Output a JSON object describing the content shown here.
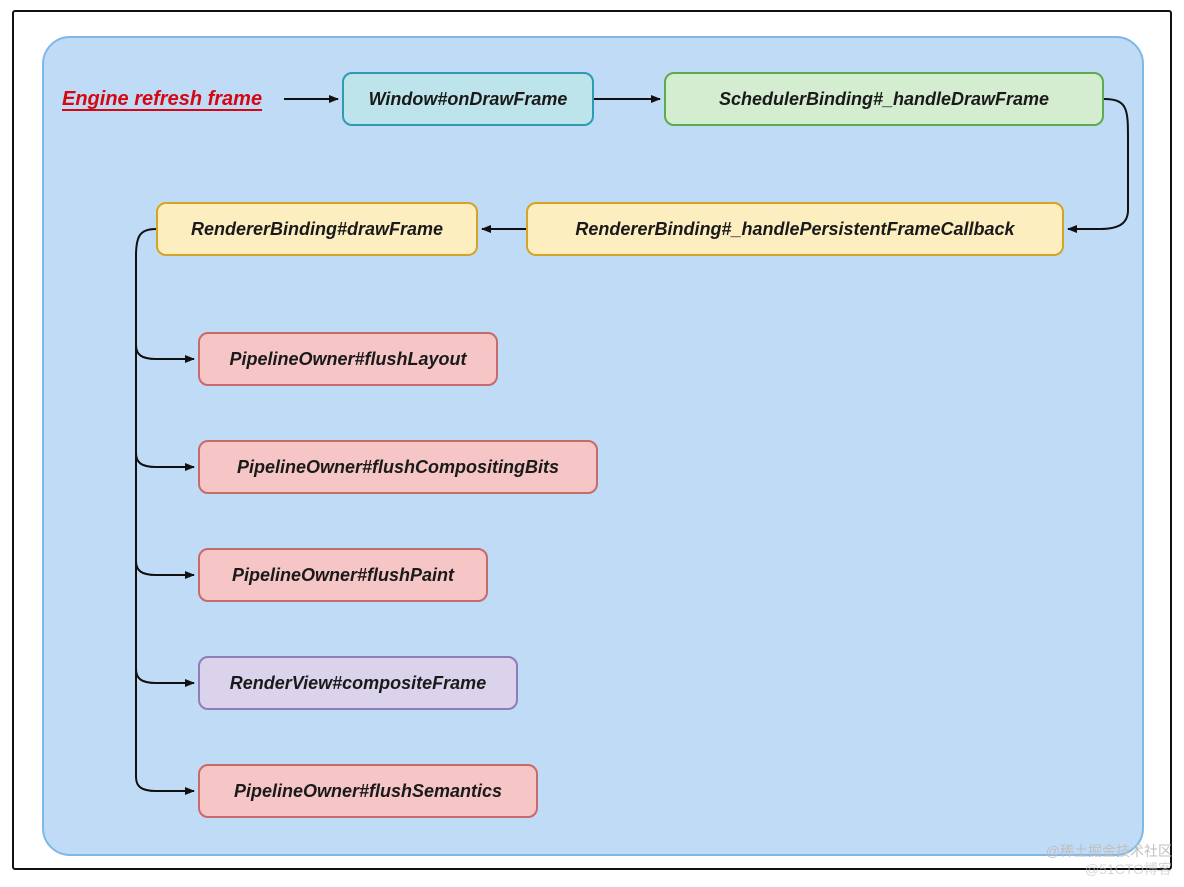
{
  "diagram": {
    "entry_label": "Engine refresh frame",
    "nodes": {
      "window_on_draw": "Window#onDrawFrame",
      "scheduler_handle": "SchedulerBinding#_handleDrawFrame",
      "renderer_persistent": "RendererBinding#_handlePersistentFrameCallback",
      "renderer_draw": "RendererBinding#drawFrame",
      "flush_layout": "PipelineOwner#flushLayout",
      "flush_compositing": "PipelineOwner#flushCompositingBits",
      "flush_paint": "PipelineOwner#flushPaint",
      "composite_frame": "RenderView#compositeFrame",
      "flush_semantics": "PipelineOwner#flushSemantics"
    }
  },
  "watermark": {
    "line1": "@稀土掘金技术社区",
    "line2": "@51CTO博客"
  },
  "colors": {
    "panel_bg": "#bfdbf6",
    "panel_border": "#7eb8e6",
    "teal_bg": "#bde4eb",
    "teal_border": "#2e9bb1",
    "green_bg": "#d4ecd0",
    "green_border": "#5bab4f",
    "yellow_bg": "#fdeec0",
    "yellow_border": "#d6a324",
    "pink_bg": "#f6c5c5",
    "pink_border": "#c76a6a",
    "purple_bg": "#dbd3ec",
    "purple_border": "#8f7db5",
    "entry_red": "#d40813"
  }
}
